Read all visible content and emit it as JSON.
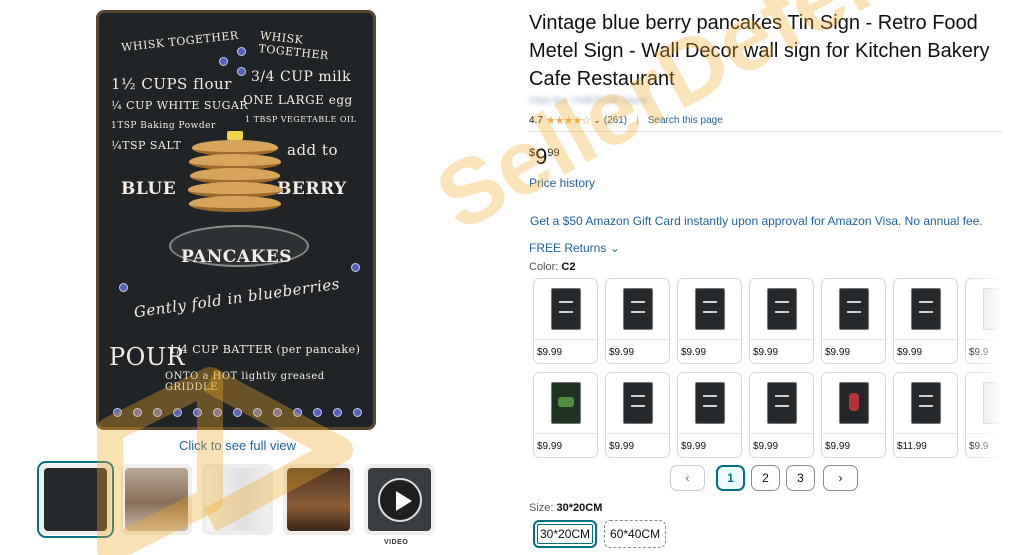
{
  "product": {
    "title": "Vintage blue berry pancakes Tin Sign - Retro Food Metel Sign - Wall Decor wall sign for Kitchen Bakery Cafe Restaurant",
    "store_link": "Visit the YMEPOR Store",
    "rating": "4.7",
    "rating_count": "(261)",
    "search_page": "Search this page",
    "price_symbol": "$",
    "price_whole": "9",
    "price_fraction": "99",
    "price_history": "Price history",
    "promo": "Get a $50 Amazon Gift Card instantly upon approval for Amazon Visa. No annual fee.",
    "returns": "FREE Returns"
  },
  "image": {
    "click_full_view": "Click to see full view",
    "sign_text": {
      "whisk_left": "WHISK TOGETHER",
      "whisk_right": "WHISK TOGETHER",
      "l1": "1½ CUPS flour",
      "l2": "¼ CUP WHITE SUGAR",
      "l3": "1TSP Baking Powder",
      "l4": "¼TSP SALT",
      "r1": "3/4 CUP milk",
      "r2": "ONE LARGE egg",
      "r3": "1 TBSP VEGETABLE OIL",
      "r4": "add to",
      "blue": "BLUE",
      "berry": "BERRY",
      "pancakes": "PANCAKES",
      "gently": "Gently fold in blueberries",
      "pour": "POUR",
      "cup_batter": "1/4 CUP BATTER (per pancake)",
      "onto": "ONTO a HOT lightly greased GRIDDLE"
    },
    "video_label": "VIDEO"
  },
  "watermark": {
    "text": "SellerDefense"
  },
  "color": {
    "label": "Color:",
    "selected": "C2",
    "swatches": [
      {
        "price": "$9.99",
        "style": "dark"
      },
      {
        "price": "$9.99",
        "style": "dark"
      },
      {
        "price": "$9.99",
        "style": "dark"
      },
      {
        "price": "$9.99",
        "style": "dark"
      },
      {
        "price": "$9.99",
        "style": "dark"
      },
      {
        "price": "$9.99",
        "style": "dark"
      },
      {
        "price": "$9.9",
        "style": "light"
      },
      {
        "price": "$9.99",
        "style": "green"
      },
      {
        "price": "$9.99",
        "style": "dark"
      },
      {
        "price": "$9.99",
        "style": "dark"
      },
      {
        "price": "$9.99",
        "style": "dark"
      },
      {
        "price": "$9.99",
        "style": "rose"
      },
      {
        "price": "$11.99",
        "style": "dark"
      },
      {
        "price": "$9.9",
        "style": "light"
      }
    ]
  },
  "pager": {
    "pages": [
      "1",
      "2",
      "3"
    ],
    "active": "1"
  },
  "size": {
    "label": "Size:",
    "selected": "30*20CM",
    "options": [
      "30*20CM",
      "60*40CM"
    ]
  },
  "colors": {
    "link": "#2162a1",
    "accent": "#007185",
    "star": "#f3a847",
    "watermark": "#f2aa28"
  }
}
